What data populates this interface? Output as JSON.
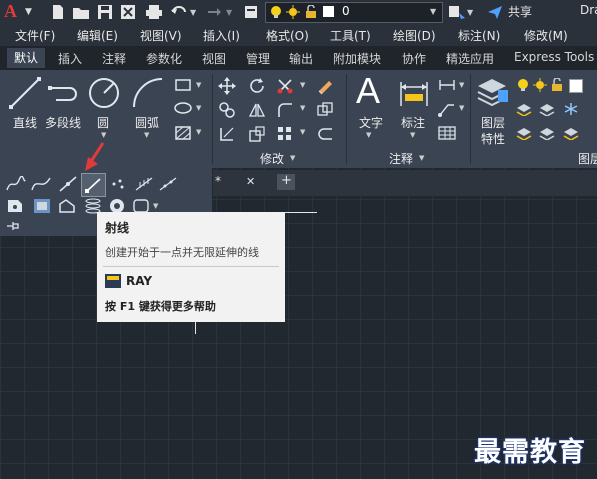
{
  "app": {
    "logo": "A",
    "title_partial": "Dra"
  },
  "quick_access": {
    "layer_value": "0",
    "share_label": "共享"
  },
  "menu": [
    "文件(F)",
    "编辑(E)",
    "视图(V)",
    "插入(I)",
    "格式(O)",
    "工具(T)",
    "绘图(D)",
    "标注(N)",
    "修改(M)"
  ],
  "tabs": [
    "默认",
    "插入",
    "注释",
    "参数化",
    "视图",
    "管理",
    "输出",
    "附加模块",
    "协作",
    "精选应用",
    "Express Tools"
  ],
  "ribbon": {
    "draw": {
      "line": "直线",
      "polyline": "多段线",
      "circle": "圆",
      "arc": "圆弧"
    },
    "modify": {
      "panel": "修改"
    },
    "annotation": {
      "text": "文字",
      "dimension": "标注",
      "panel": "注释"
    },
    "layers": {
      "props_line1": "图层",
      "props_line2": "特性",
      "panel_partial": "图层"
    }
  },
  "tooltip": {
    "title": "射线",
    "description": "创建开始于一点并无限延伸的线",
    "command": "RAY",
    "help": "按 F1 键获得更多帮助"
  },
  "doc_tab": {
    "label": "*",
    "close": "✕",
    "add": "+"
  },
  "watermark": "最需教育",
  "colors": {
    "accent_red": "#e03a3a",
    "ribbon_bg": "#3b4452",
    "canvas_bg": "#212830",
    "share_blue": "#4ea1ff"
  }
}
